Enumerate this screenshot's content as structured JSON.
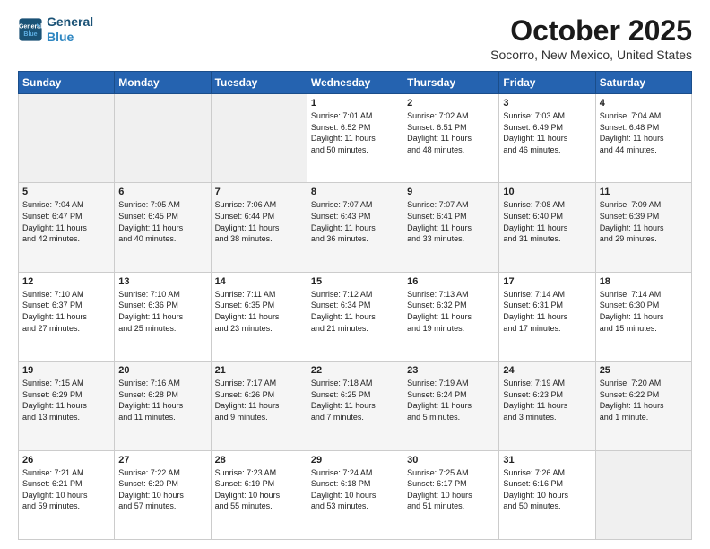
{
  "header": {
    "logo_line1": "General",
    "logo_line2": "Blue",
    "title": "October 2025",
    "subtitle": "Socorro, New Mexico, United States"
  },
  "days_of_week": [
    "Sunday",
    "Monday",
    "Tuesday",
    "Wednesday",
    "Thursday",
    "Friday",
    "Saturday"
  ],
  "weeks": [
    [
      {
        "date": "",
        "info": ""
      },
      {
        "date": "",
        "info": ""
      },
      {
        "date": "",
        "info": ""
      },
      {
        "date": "1",
        "info": "Sunrise: 7:01 AM\nSunset: 6:52 PM\nDaylight: 11 hours\nand 50 minutes."
      },
      {
        "date": "2",
        "info": "Sunrise: 7:02 AM\nSunset: 6:51 PM\nDaylight: 11 hours\nand 48 minutes."
      },
      {
        "date": "3",
        "info": "Sunrise: 7:03 AM\nSunset: 6:49 PM\nDaylight: 11 hours\nand 46 minutes."
      },
      {
        "date": "4",
        "info": "Sunrise: 7:04 AM\nSunset: 6:48 PM\nDaylight: 11 hours\nand 44 minutes."
      }
    ],
    [
      {
        "date": "5",
        "info": "Sunrise: 7:04 AM\nSunset: 6:47 PM\nDaylight: 11 hours\nand 42 minutes."
      },
      {
        "date": "6",
        "info": "Sunrise: 7:05 AM\nSunset: 6:45 PM\nDaylight: 11 hours\nand 40 minutes."
      },
      {
        "date": "7",
        "info": "Sunrise: 7:06 AM\nSunset: 6:44 PM\nDaylight: 11 hours\nand 38 minutes."
      },
      {
        "date": "8",
        "info": "Sunrise: 7:07 AM\nSunset: 6:43 PM\nDaylight: 11 hours\nand 36 minutes."
      },
      {
        "date": "9",
        "info": "Sunrise: 7:07 AM\nSunset: 6:41 PM\nDaylight: 11 hours\nand 33 minutes."
      },
      {
        "date": "10",
        "info": "Sunrise: 7:08 AM\nSunset: 6:40 PM\nDaylight: 11 hours\nand 31 minutes."
      },
      {
        "date": "11",
        "info": "Sunrise: 7:09 AM\nSunset: 6:39 PM\nDaylight: 11 hours\nand 29 minutes."
      }
    ],
    [
      {
        "date": "12",
        "info": "Sunrise: 7:10 AM\nSunset: 6:37 PM\nDaylight: 11 hours\nand 27 minutes."
      },
      {
        "date": "13",
        "info": "Sunrise: 7:10 AM\nSunset: 6:36 PM\nDaylight: 11 hours\nand 25 minutes."
      },
      {
        "date": "14",
        "info": "Sunrise: 7:11 AM\nSunset: 6:35 PM\nDaylight: 11 hours\nand 23 minutes."
      },
      {
        "date": "15",
        "info": "Sunrise: 7:12 AM\nSunset: 6:34 PM\nDaylight: 11 hours\nand 21 minutes."
      },
      {
        "date": "16",
        "info": "Sunrise: 7:13 AM\nSunset: 6:32 PM\nDaylight: 11 hours\nand 19 minutes."
      },
      {
        "date": "17",
        "info": "Sunrise: 7:14 AM\nSunset: 6:31 PM\nDaylight: 11 hours\nand 17 minutes."
      },
      {
        "date": "18",
        "info": "Sunrise: 7:14 AM\nSunset: 6:30 PM\nDaylight: 11 hours\nand 15 minutes."
      }
    ],
    [
      {
        "date": "19",
        "info": "Sunrise: 7:15 AM\nSunset: 6:29 PM\nDaylight: 11 hours\nand 13 minutes."
      },
      {
        "date": "20",
        "info": "Sunrise: 7:16 AM\nSunset: 6:28 PM\nDaylight: 11 hours\nand 11 minutes."
      },
      {
        "date": "21",
        "info": "Sunrise: 7:17 AM\nSunset: 6:26 PM\nDaylight: 11 hours\nand 9 minutes."
      },
      {
        "date": "22",
        "info": "Sunrise: 7:18 AM\nSunset: 6:25 PM\nDaylight: 11 hours\nand 7 minutes."
      },
      {
        "date": "23",
        "info": "Sunrise: 7:19 AM\nSunset: 6:24 PM\nDaylight: 11 hours\nand 5 minutes."
      },
      {
        "date": "24",
        "info": "Sunrise: 7:19 AM\nSunset: 6:23 PM\nDaylight: 11 hours\nand 3 minutes."
      },
      {
        "date": "25",
        "info": "Sunrise: 7:20 AM\nSunset: 6:22 PM\nDaylight: 11 hours\nand 1 minute."
      }
    ],
    [
      {
        "date": "26",
        "info": "Sunrise: 7:21 AM\nSunset: 6:21 PM\nDaylight: 10 hours\nand 59 minutes."
      },
      {
        "date": "27",
        "info": "Sunrise: 7:22 AM\nSunset: 6:20 PM\nDaylight: 10 hours\nand 57 minutes."
      },
      {
        "date": "28",
        "info": "Sunrise: 7:23 AM\nSunset: 6:19 PM\nDaylight: 10 hours\nand 55 minutes."
      },
      {
        "date": "29",
        "info": "Sunrise: 7:24 AM\nSunset: 6:18 PM\nDaylight: 10 hours\nand 53 minutes."
      },
      {
        "date": "30",
        "info": "Sunrise: 7:25 AM\nSunset: 6:17 PM\nDaylight: 10 hours\nand 51 minutes."
      },
      {
        "date": "31",
        "info": "Sunrise: 7:26 AM\nSunset: 6:16 PM\nDaylight: 10 hours\nand 50 minutes."
      },
      {
        "date": "",
        "info": ""
      }
    ]
  ]
}
